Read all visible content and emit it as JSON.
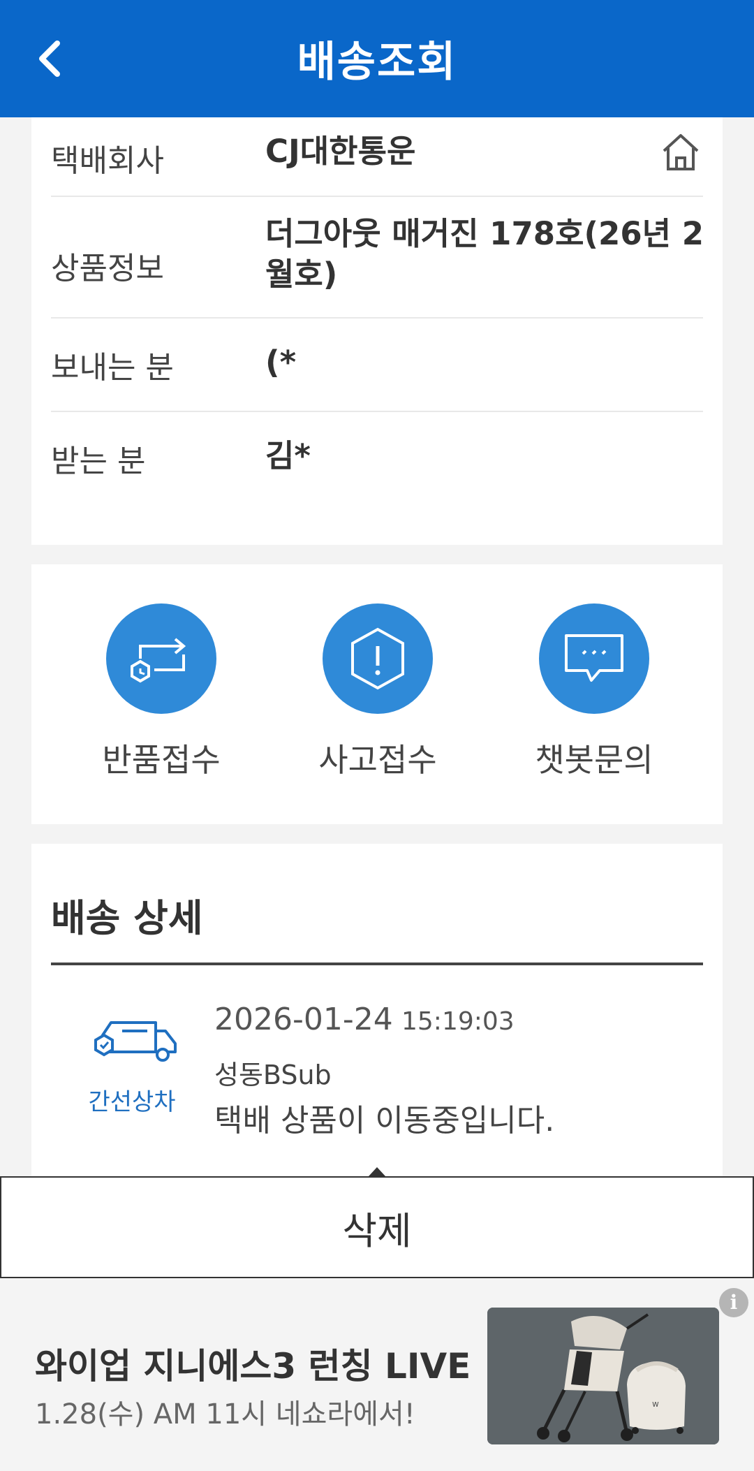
{
  "header": {
    "title": "배송조회",
    "back_icon": "chevron-left-icon"
  },
  "info": {
    "rows": [
      {
        "label": "택배회사",
        "value": "CJ대한통운"
      },
      {
        "label": "상품정보",
        "value": "더그아웃 매거진 178호(26년 2월호)"
      },
      {
        "label": "보내는 분",
        "value": "(*"
      },
      {
        "label": "받는 분",
        "value": "김*"
      }
    ],
    "home_icon": "home-icon"
  },
  "actions": [
    {
      "label": "반품접수",
      "icon": "return-icon"
    },
    {
      "label": "사고접수",
      "icon": "alert-hexagon-icon"
    },
    {
      "label": "챗봇문의",
      "icon": "chat-bubble-icon"
    }
  ],
  "detail": {
    "title": "배송 상세",
    "events": [
      {
        "status": "간선상차",
        "date": "2026-01-24",
        "time": "15:19:03",
        "location": "성동BSub",
        "description": "택배 상품이 이동중입니다."
      }
    ]
  },
  "delete_button": {
    "label": "삭제"
  },
  "ad": {
    "title": "와이업 지니에스3 런칭 LIVE",
    "subtitle": "1.28(수) AM 11시 네쇼라에서!",
    "info_label": "i"
  },
  "colors": {
    "header": "#0a67c9",
    "action_circle": "#2f8ad8",
    "status_text": "#1f6fc0"
  }
}
